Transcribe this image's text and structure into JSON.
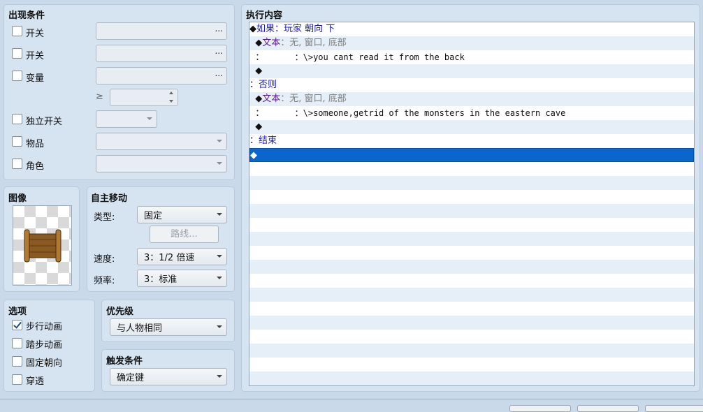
{
  "conditions": {
    "title": "出现条件",
    "switch1_label": "开关",
    "switch2_label": "开关",
    "variable_label": "变量",
    "variable_op": "≥",
    "self_switch_label": "独立开关",
    "item_label": "物品",
    "actor_label": "角色",
    "ellipsis": "..."
  },
  "image": {
    "title": "图像"
  },
  "autonomous": {
    "title": "自主移动",
    "type_label": "类型:",
    "type_value": "固定",
    "route_button": "路线...",
    "speed_label": "速度:",
    "speed_value": "3：1/2 倍速",
    "freq_label": "频率:",
    "freq_value": "3：标准"
  },
  "options": {
    "title": "选项",
    "walking_anim": "步行动画",
    "stepping_anim": "踏步动画",
    "direction_fix": "固定朝向",
    "through": "穿透",
    "walking_anim_checked": true
  },
  "priority": {
    "title": "优先级",
    "value": "与人物相同"
  },
  "trigger": {
    "title": "触发条件",
    "value": "确定键"
  },
  "contents": {
    "title": "执行内容",
    "lines": [
      {
        "a": "◆",
        "b": "如果：玩家 朝向 下"
      },
      {
        "a": "  ◆",
        "b": "文本",
        "c": "：无, 窗口, 底部"
      },
      {
        "a": "  ：",
        "b": "      ：\\>you cant read it from the back"
      },
      {
        "a": "  ◆",
        "b": ""
      },
      {
        "a": "：",
        "b": "否则"
      },
      {
        "a": "  ◆",
        "b": "文本",
        "c": "：无, 窗口, 底部"
      },
      {
        "a": "  ：",
        "b": "      ：\\>someone,getrid of the monsters in the eastern cave"
      },
      {
        "a": "  ◆",
        "b": ""
      },
      {
        "a": "：",
        "b": "结束"
      },
      {
        "a": "◆",
        "b": ""
      }
    ]
  }
}
